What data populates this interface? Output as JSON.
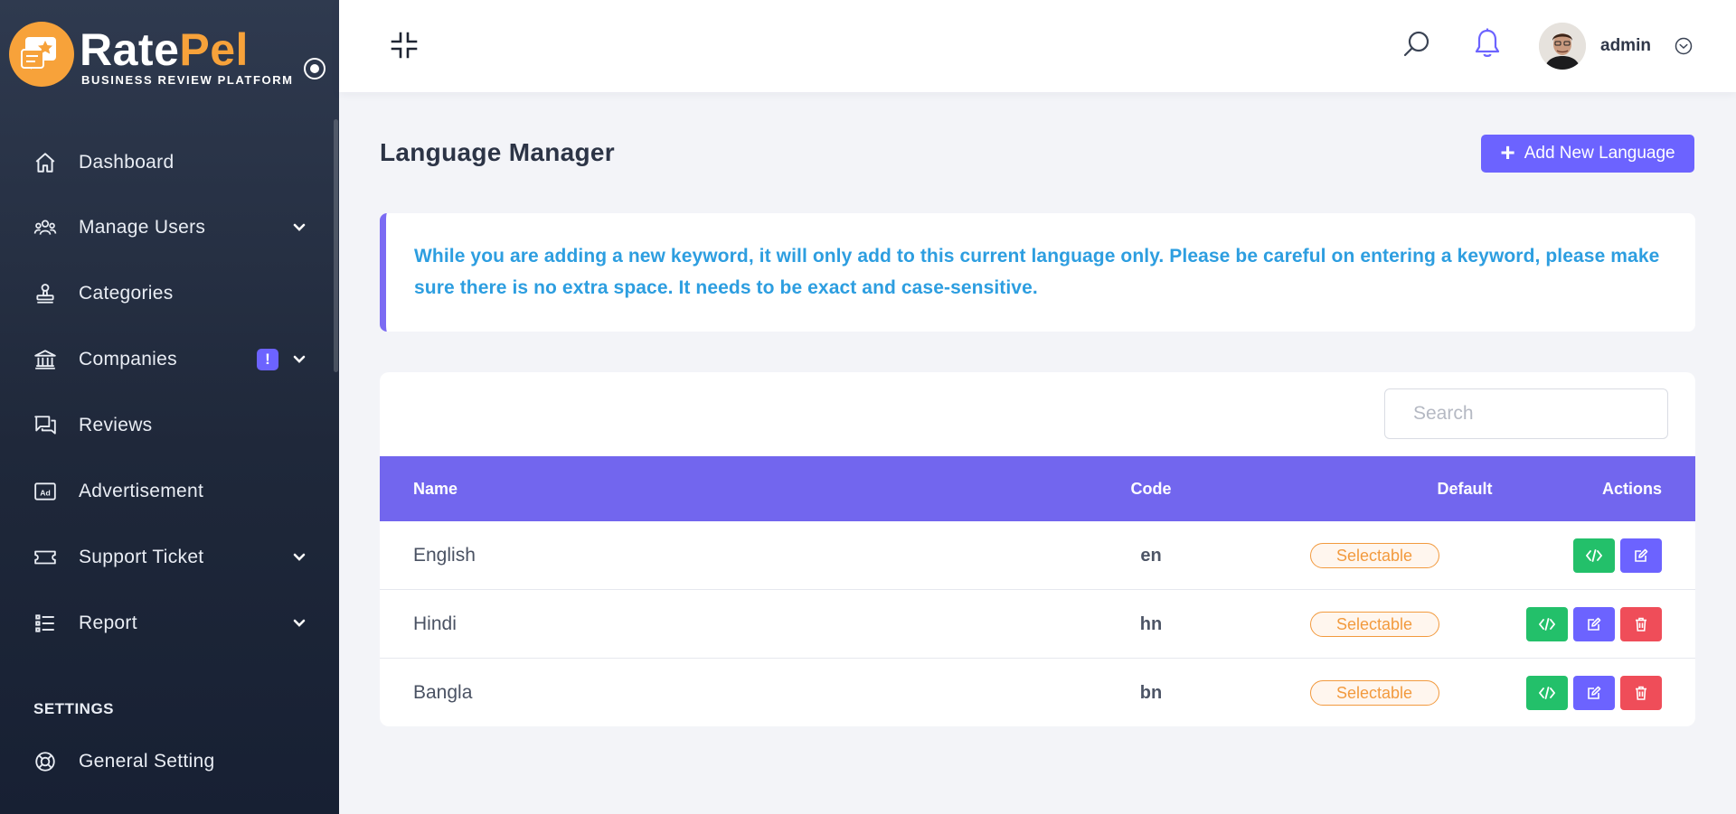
{
  "brand": {
    "name_part1": "Rate",
    "name_part2": "Pel",
    "tagline": "BUSINESS REVIEW PLATFORM",
    "accent": "#f7a23a"
  },
  "sidebar": {
    "items": [
      {
        "label": "Dashboard",
        "icon": "home-icon",
        "caret": false
      },
      {
        "label": "Manage Users",
        "icon": "users-icon",
        "caret": true
      },
      {
        "label": "Categories",
        "icon": "stamp-icon",
        "caret": false
      },
      {
        "label": "Companies",
        "icon": "bank-icon",
        "caret": true,
        "badge": "!"
      },
      {
        "label": "Reviews",
        "icon": "chat-icon",
        "caret": false
      },
      {
        "label": "Advertisement",
        "icon": "ad-icon",
        "caret": false
      },
      {
        "label": "Support Ticket",
        "icon": "ticket-icon",
        "caret": true
      },
      {
        "label": "Report",
        "icon": "list-icon",
        "caret": true
      }
    ],
    "section_title": "SETTINGS",
    "settings_items": [
      {
        "label": "General Setting",
        "icon": "lifebuoy-icon"
      }
    ]
  },
  "topbar": {
    "user_name": "admin"
  },
  "page": {
    "title": "Language Manager",
    "add_button_label": "Add New Language",
    "notice": "While you are adding a new keyword, it will only add to this current language only. Please be careful on entering a keyword, please make sure there is no extra space. It needs to be exact and case-sensitive."
  },
  "table": {
    "search_placeholder": "Search",
    "headers": {
      "name": "Name",
      "code": "Code",
      "default": "Default",
      "actions": "Actions"
    },
    "rows": [
      {
        "name": "English",
        "code": "en",
        "default": "Selectable",
        "deletable": false
      },
      {
        "name": "Hindi",
        "code": "hn",
        "default": "Selectable",
        "deletable": true
      },
      {
        "name": "Bangla",
        "code": "bn",
        "default": "Selectable",
        "deletable": true
      }
    ]
  },
  "colors": {
    "primary": "#6c63ff",
    "success": "#23c06a",
    "danger": "#ef4d59",
    "notice_text": "#2d9ee0",
    "sidebar_bg": "#1f283a"
  }
}
